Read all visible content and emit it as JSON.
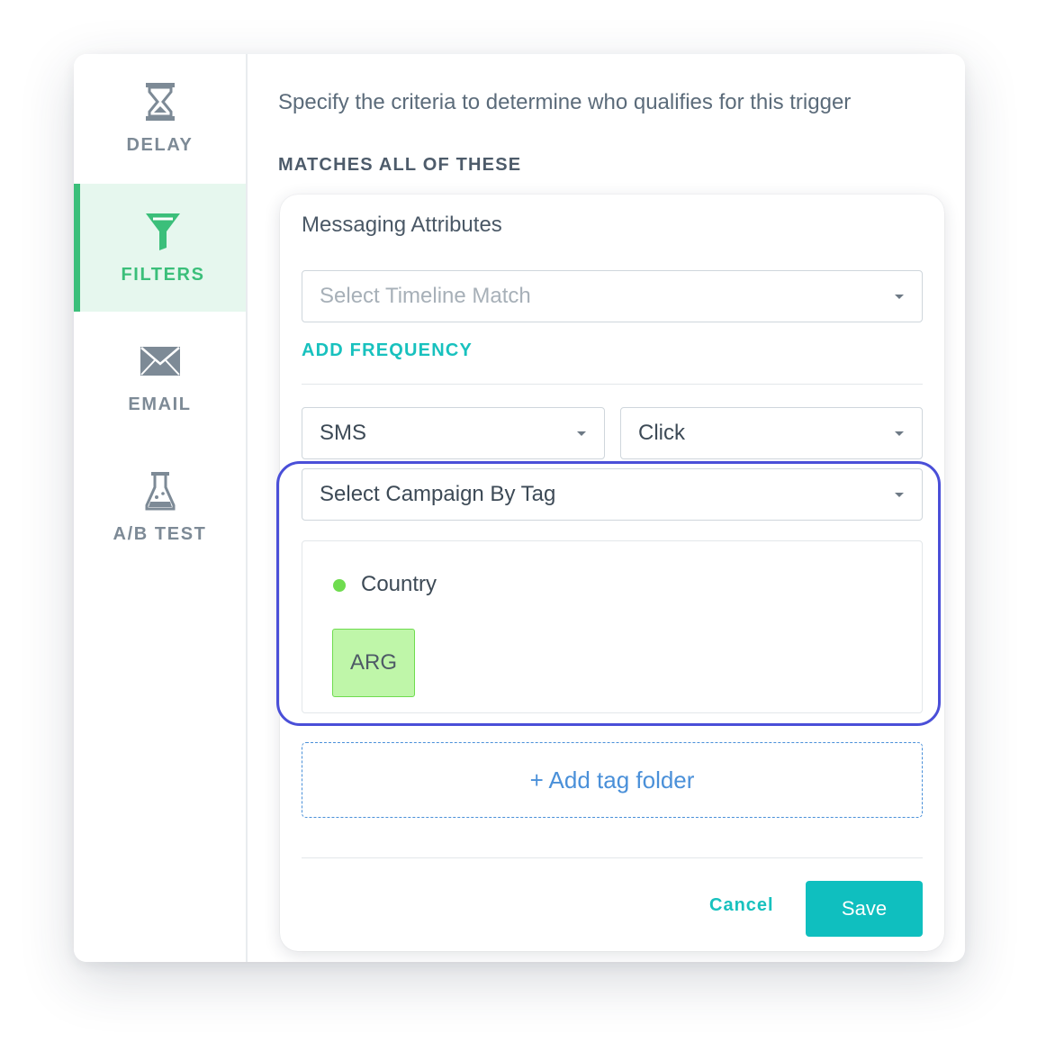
{
  "sidebar": {
    "items": [
      {
        "label": "DELAY",
        "icon": "hourglass-icon",
        "active": false
      },
      {
        "label": "FILTERS",
        "icon": "funnel-icon",
        "active": true
      },
      {
        "label": "EMAIL",
        "icon": "envelope-icon",
        "active": false
      },
      {
        "label": "A/B TEST",
        "icon": "flask-icon",
        "active": false
      }
    ]
  },
  "main": {
    "description": "Specify the criteria to determine who qualifies for this trigger",
    "section_title": "MATCHES ALL OF THESE",
    "card": {
      "title": "Messaging Attributes",
      "timeline_select": {
        "placeholder": "Select Timeline Match"
      },
      "add_frequency_label": "ADD FREQUENCY",
      "channel_select": {
        "value": "SMS"
      },
      "action_select": {
        "value": "Click"
      },
      "campaign_select": {
        "value": "Select Campaign By Tag"
      },
      "tag_group": {
        "folder": "Country",
        "tags": [
          "ARG"
        ]
      },
      "add_tag_folder_label": "+ Add tag folder",
      "cancel_label": "Cancel",
      "save_label": "Save"
    }
  },
  "colors": {
    "accent_green": "#3bbf7a",
    "teal": "#0fbfbf",
    "highlight": "#4a4fd8",
    "tag_green": "#bff6a9",
    "link_blue": "#4a90d9"
  }
}
